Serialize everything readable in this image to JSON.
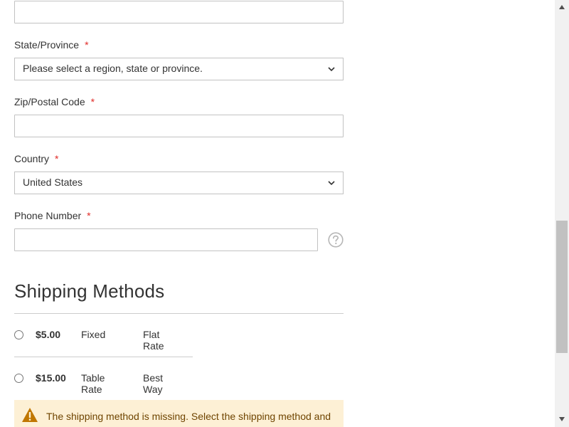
{
  "form": {
    "state": {
      "label": "State/Province",
      "required_mark": "*",
      "selected": "Please select a region, state or province."
    },
    "zip": {
      "label": "Zip/Postal Code",
      "required_mark": "*",
      "value": ""
    },
    "country": {
      "label": "Country",
      "required_mark": "*",
      "selected": "United States"
    },
    "phone": {
      "label": "Phone Number",
      "required_mark": "*",
      "value": ""
    },
    "street_line": {
      "value": ""
    }
  },
  "shipping": {
    "title": "Shipping Methods",
    "methods": [
      {
        "price": "$5.00",
        "method": "Fixed",
        "carrier": "Flat Rate"
      },
      {
        "price": "$15.00",
        "method": "Table Rate",
        "carrier": "Best Way"
      }
    ],
    "warning": "The shipping method is missing. Select the shipping method and try again."
  },
  "icons": {
    "chevron": "chevron-down-icon",
    "help": "help-icon",
    "warning": "warning-icon"
  },
  "colors": {
    "required": "#e02b27",
    "warning_bg": "#fdf0d5",
    "warning_text": "#6f4400",
    "warning_icon": "#c07600"
  }
}
